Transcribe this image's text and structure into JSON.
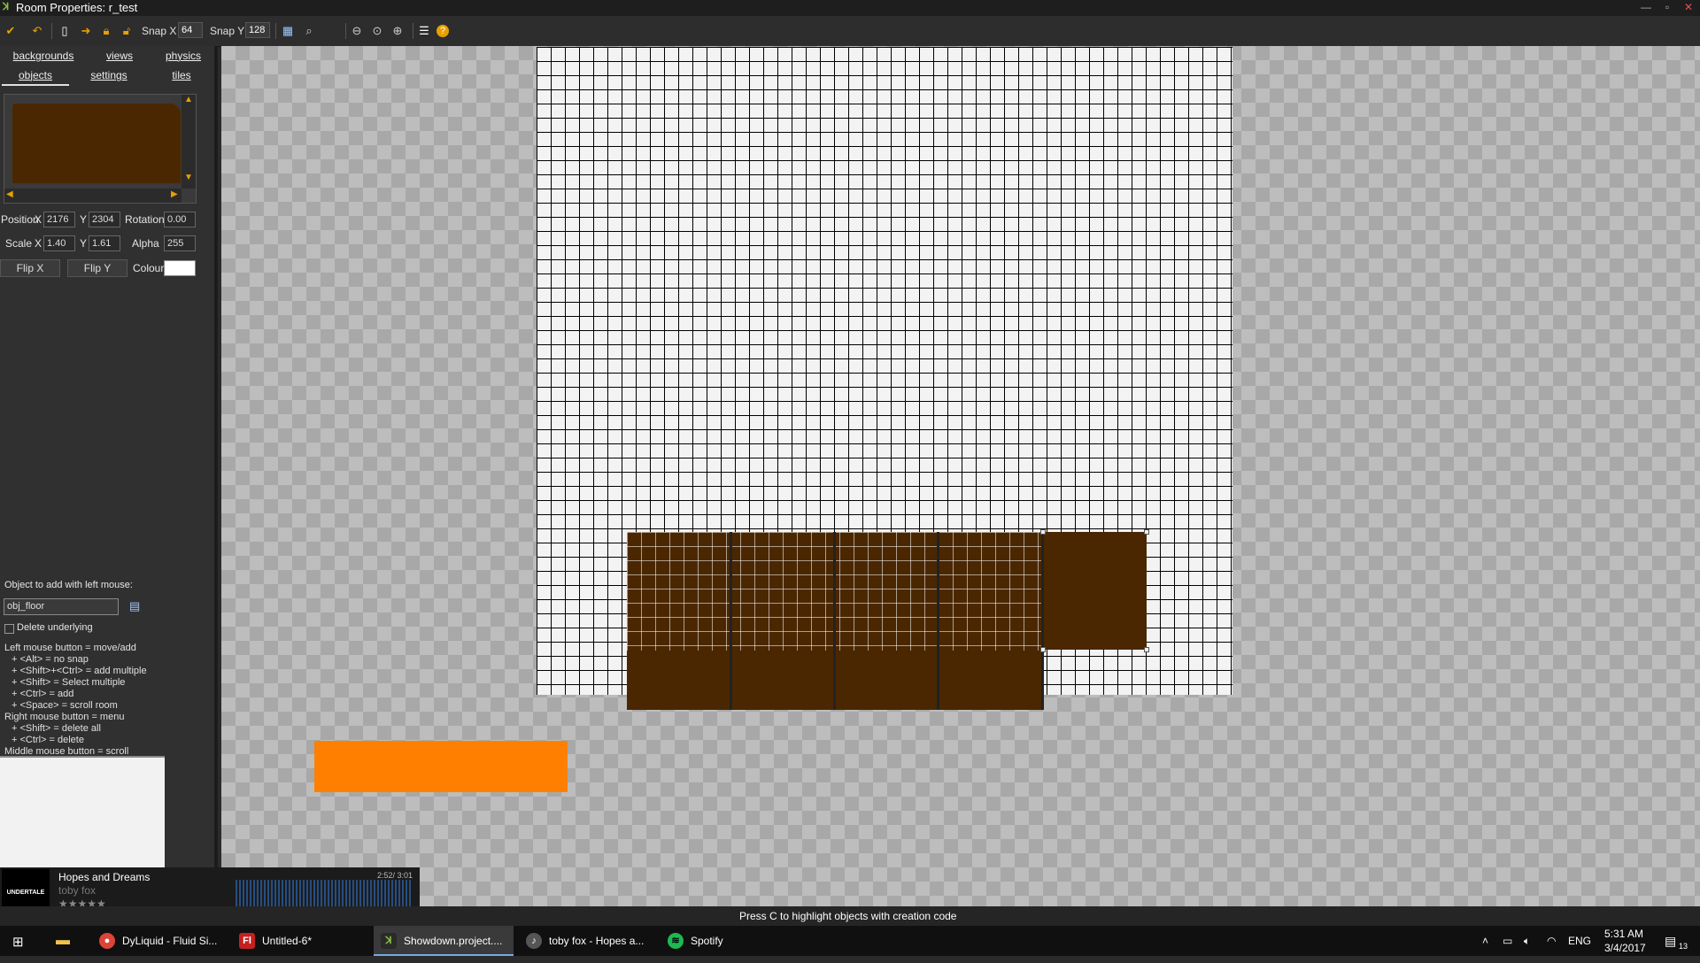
{
  "window": {
    "title": "Room Properties: r_test",
    "minimize": "—",
    "maximize": "▫",
    "close": "✕"
  },
  "toolbar": {
    "snap_x_label": "Snap X",
    "snap_x_value": "64",
    "snap_y_label": "Snap Y",
    "snap_y_value": "128"
  },
  "tabs": [
    {
      "label": "backgrounds"
    },
    {
      "label": "views"
    },
    {
      "label": "physics"
    },
    {
      "label": "objects"
    },
    {
      "label": "settings"
    },
    {
      "label": "tiles"
    }
  ],
  "props": {
    "position_label": "Position",
    "x_label": "X",
    "pos_x": "2176",
    "y_label": "Y",
    "pos_y": "2304",
    "rotation_label": "Rotation",
    "rotation": "0.00",
    "scale_label": "Scale",
    "scale_x": "1.40",
    "scale_y": "1.61",
    "alpha_label": "Alpha",
    "alpha": "255",
    "flip_x": "Flip X",
    "flip_y": "Flip Y",
    "colour_label": "Colour",
    "colour": "#ffffff"
  },
  "object_add": {
    "label": "Object to add with left mouse:",
    "value": "obj_floor",
    "delete_underlying": "Delete underlying"
  },
  "help": [
    "Left mouse button = move/add",
    "  + <Alt> = no snap",
    "  + <Shift>+<Ctrl> = add multiple",
    "  + <Shift> = Select multiple",
    "  + <Ctrl> = add",
    "  + <Space> = scroll room",
    "Right mouse button = menu",
    "  + <Shift> = delete all",
    "  + <Ctrl> = delete",
    "Middle mouse button = scroll"
  ],
  "colors": {
    "floor": "#4a2700",
    "orange_block": "#ff8000",
    "accent": "#f5d000"
  },
  "status": {
    "text": "Press C to highlight objects with creation code"
  },
  "music": {
    "title": "Hopes and Dreams",
    "artist": "toby fox",
    "time": "2:52/ 3:01",
    "album_art_text": "UNDERTALE",
    "rating_stars": "★★★★★",
    "progress": 0.95
  },
  "taskbar": {
    "items": [
      {
        "label": "DyLiquid - Fluid Si...",
        "icon": "chrome-icon"
      },
      {
        "label": "Untitled-6*",
        "icon": "flash-icon"
      },
      {
        "label": "Showdown.project....",
        "icon": "gamemaker-icon"
      },
      {
        "label": "toby fox - Hopes a...",
        "icon": "music-player-icon"
      },
      {
        "label": "Spotify",
        "icon": "spotify-icon"
      }
    ],
    "language": "ENG",
    "time": "5:31 AM",
    "date": "3/4/2017",
    "notifications": "13"
  }
}
